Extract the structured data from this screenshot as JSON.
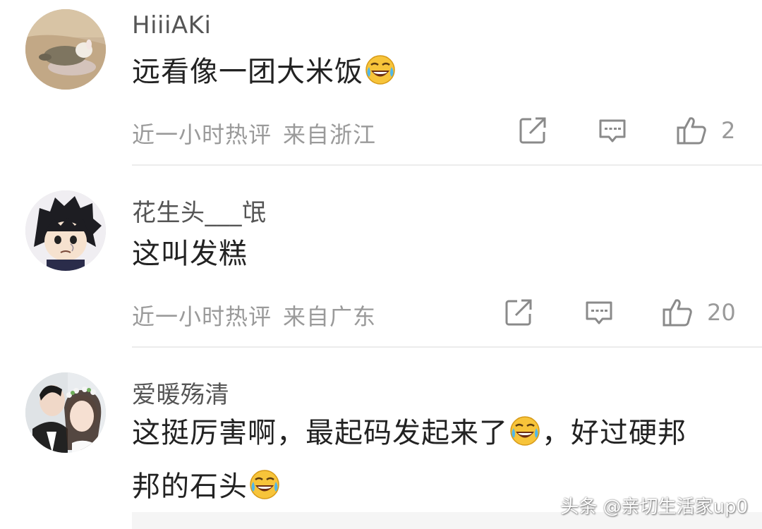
{
  "comments": [
    {
      "username": "HiiiAKi",
      "text": "远看像一团大米饭",
      "time": "近一小时热评",
      "location": "来自浙江",
      "likes": "2"
    },
    {
      "username": "花生头___氓",
      "text": "这叫发糕",
      "time": "近一小时热评",
      "location": "来自广东",
      "likes": "20"
    },
    {
      "username": "爱暖殇清",
      "text_part1": "这挺厉害啊，最起码发起来了",
      "text_part2": "，好过硬邦",
      "text_part3": "邦的石头"
    }
  ],
  "watermark": "头条 @亲切生活家up0",
  "icons": {
    "share": "share-icon",
    "reply": "comment-icon",
    "like": "thumbs-up-icon",
    "emoji": "tears-of-joy-emoji-icon"
  },
  "colors": {
    "username": "#555555",
    "text": "#222222",
    "meta": "#9a9a9a",
    "divider": "#ececec"
  }
}
